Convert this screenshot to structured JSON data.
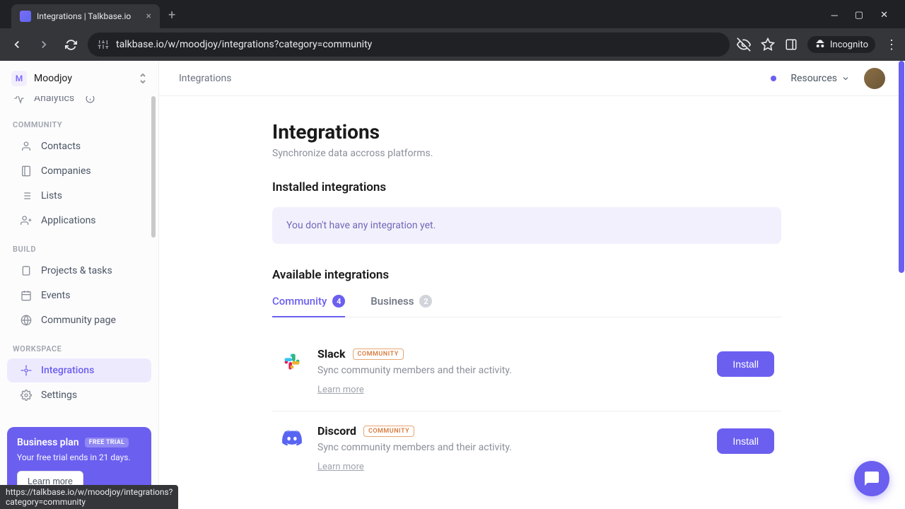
{
  "browser": {
    "tab_title": "Integrations | Talkbase.io",
    "url": "talkbase.io/w/moodjoy/integrations?category=community",
    "incognito_label": "Incognito",
    "status_url": "https://talkbase.io/w/moodjoy/integrations?category=community"
  },
  "workspace": {
    "initial": "M",
    "name": "Moodjoy"
  },
  "sidebar": {
    "partial_item": "Analytics",
    "sections": {
      "community": {
        "label": "COMMUNITY",
        "items": [
          "Contacts",
          "Companies",
          "Lists",
          "Applications"
        ]
      },
      "build": {
        "label": "BUILD",
        "items": [
          "Projects & tasks",
          "Events",
          "Community page"
        ]
      },
      "workspace": {
        "label": "WORKSPACE",
        "items": [
          "Integrations",
          "Settings"
        ]
      }
    }
  },
  "promo": {
    "title": "Business plan",
    "badge": "FREE TRIAL",
    "text": "Your free trial ends in 21 days.",
    "button": "Learn more"
  },
  "topbar": {
    "breadcrumb": "Integrations",
    "resources": "Resources"
  },
  "page": {
    "title": "Integrations",
    "subtitle": "Synchronize data accross platforms.",
    "installed_heading": "Installed integrations",
    "empty_message": "You don't have any integration yet.",
    "available_heading": "Available integrations"
  },
  "tabs": {
    "community": {
      "label": "Community",
      "count": "4"
    },
    "business": {
      "label": "Business",
      "count": "2"
    }
  },
  "integrations": [
    {
      "name": "Slack",
      "tag": "COMMUNITY",
      "desc": "Sync community members and their activity.",
      "learn": "Learn more",
      "install": "Install"
    },
    {
      "name": "Discord",
      "tag": "COMMUNITY",
      "desc": "Sync community members and their activity.",
      "learn": "Learn more",
      "install": "Install"
    }
  ]
}
